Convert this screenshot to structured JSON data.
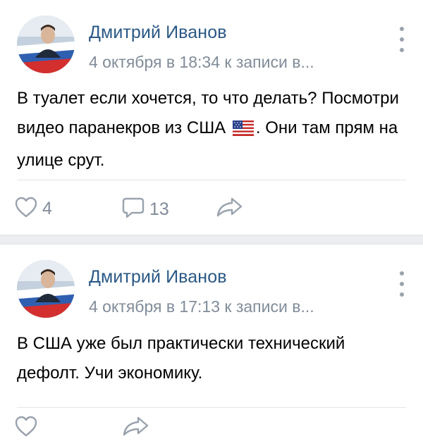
{
  "posts": [
    {
      "author": "Дмитрий Иванов",
      "meta": "4 октября в 18:34 к записи в...",
      "text_before_flag": "В туалет если хочется, то что делать? Посмотри видео паранекров из США ",
      "text_after_flag": ". Они там прям на улице срут.",
      "likes": "4",
      "comments": "13"
    },
    {
      "author": "Дмитрий Иванов",
      "meta": "4 октября в 17:13 к записи в...",
      "text": "В США уже был практически технический дефолт. Учи экономику."
    }
  ],
  "icons": {
    "like": "heart-icon",
    "comment": "comment-icon",
    "share": "share-icon",
    "menu": "more-vertical-icon",
    "flag": "us-flag-emoji"
  },
  "colors": {
    "author": "#2a5885",
    "meta": "#818c99",
    "icon": "#99a2ad",
    "divider": "#ebedf0"
  }
}
